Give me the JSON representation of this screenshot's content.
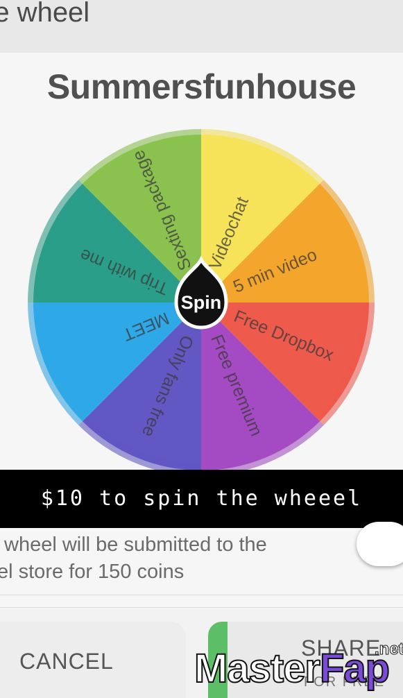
{
  "header": {
    "title": "re wheel"
  },
  "wheel": {
    "title": "Summersfunhouse",
    "center_label": "Spin",
    "segments": [
      {
        "label": "Videochat",
        "color": "#f7e35a"
      },
      {
        "label": "5 min video",
        "color": "#f4a52c"
      },
      {
        "label": "Free Dropbox",
        "color": "#ee5a4c"
      },
      {
        "label": "Free premium",
        "color": "#a44ac3"
      },
      {
        "label": "Only fans free",
        "color": "#6158c4"
      },
      {
        "label": "MEET",
        "color": "#2fa8e8"
      },
      {
        "label": "Trip with me",
        "color": "#2a9e88"
      },
      {
        "label": "Sexting package",
        "color": "#8bc24f"
      }
    ]
  },
  "caption": {
    "text": "$10 to spin the wheeel"
  },
  "settings": {
    "submit_line1": "wheel will be submitted to the",
    "submit_line2": "el store for 150 coins"
  },
  "actions": {
    "cancel_label": "CANCEL",
    "share_label": "SHARE",
    "share_sub": "FOR FREE"
  },
  "watermark": {
    "part1": "Master",
    "part2": "Fap",
    "suffix": ".net"
  }
}
